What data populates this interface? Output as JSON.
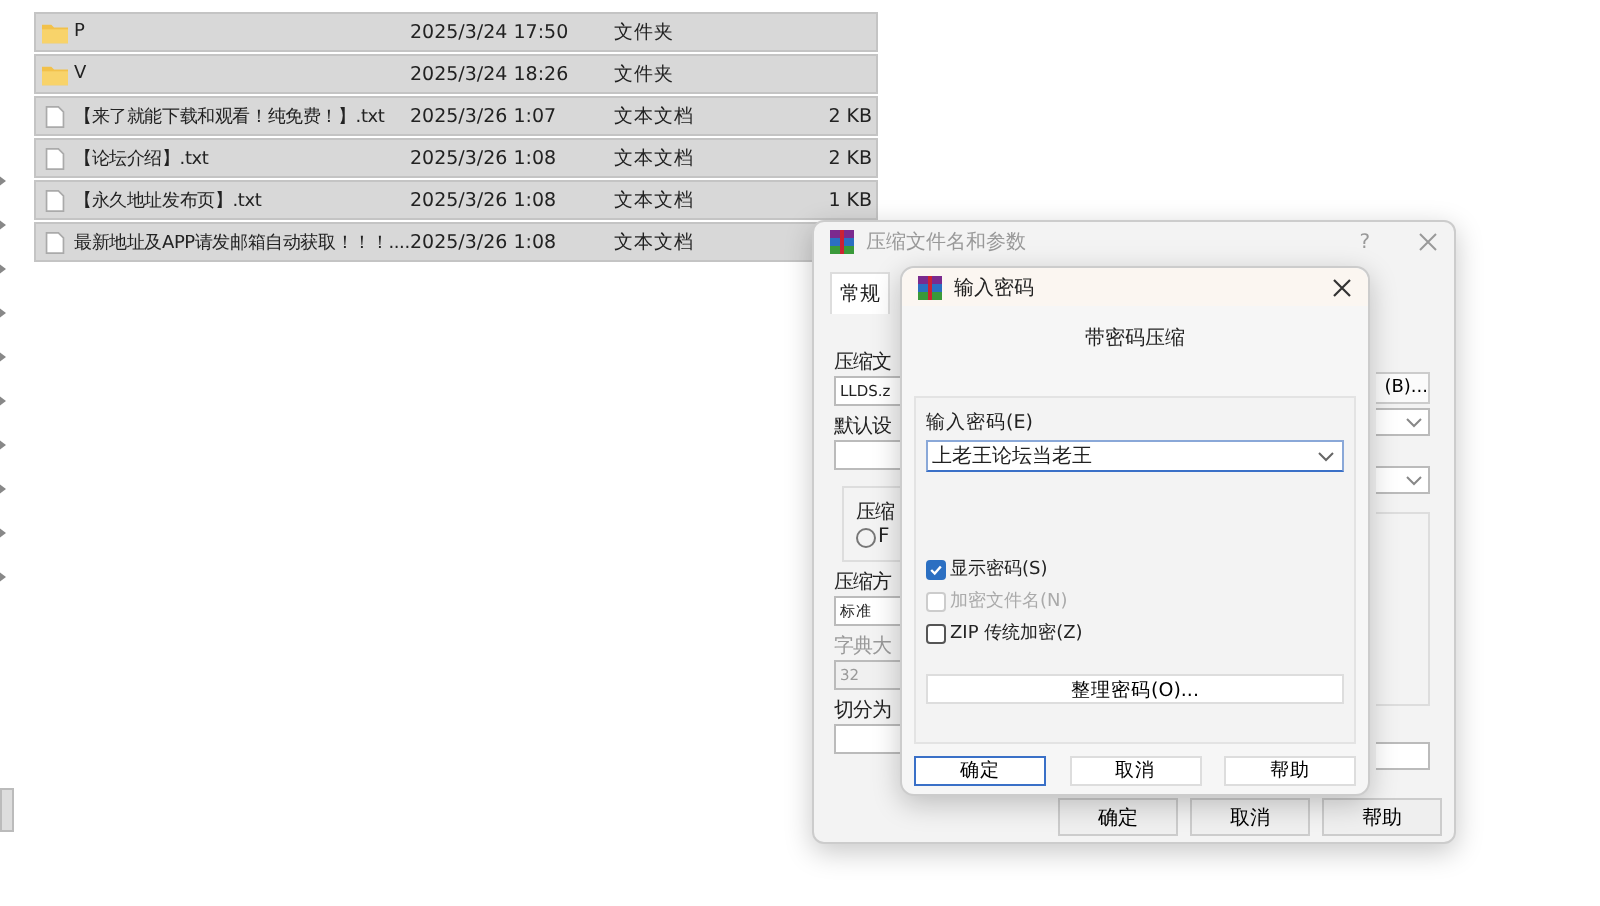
{
  "file_list": {
    "rows": [
      {
        "kind": "folder",
        "name": "P",
        "date": "2025/3/24 17:50",
        "type": "文件夹"
      },
      {
        "kind": "folder",
        "name": "V",
        "date": "2025/3/24 18:26",
        "type": "文件夹"
      },
      {
        "kind": "file",
        "name": "【来了就能下载和观看！纯免费！】.txt",
        "date": "2025/3/26 1:07",
        "type": "文本文档",
        "size": "2 KB"
      },
      {
        "kind": "file",
        "name": "【论坛介绍】.txt",
        "date": "2025/3/26 1:08",
        "type": "文本文档",
        "size": "2 KB"
      },
      {
        "kind": "file",
        "name": "【永久地址发布页】.txt",
        "date": "2025/3/26 1:08",
        "type": "文本文档",
        "size": "1 KB"
      },
      {
        "kind": "file",
        "name": "最新地址及APP请发邮箱自动获取！！！....",
        "date": "2025/3/26 1:08",
        "type": "文本文档"
      }
    ]
  },
  "archive_dialog": {
    "title": "压缩文件名和参数",
    "help_mark": "?",
    "tabs": [
      {
        "label": "常规",
        "selected": true
      }
    ],
    "archive_name_label": "压缩文",
    "archive_name_value": "LLDS.z",
    "browse_button": "(B)...",
    "profile_label": "默认设",
    "format_label": "压缩",
    "format_option": {
      "label": "F",
      "checked": false
    },
    "method_label": "压缩方",
    "method_value": "标准",
    "dictionary_label": "字典大",
    "dictionary_value": "32",
    "split_label": "切分为",
    "buttons": [
      "确定",
      "取消",
      "帮助"
    ]
  },
  "password_dialog": {
    "title": "输入密码",
    "heading": "带密码压缩",
    "password_label": "输入密码(E)",
    "password_value": "上老王论坛当老王",
    "options": [
      {
        "label": "显示密码(S)",
        "checked": true,
        "disabled": false
      },
      {
        "label": "加密文件名(N)",
        "checked": false,
        "disabled": true
      },
      {
        "label": "ZIP 传统加密(Z)",
        "checked": false,
        "disabled": false
      }
    ],
    "organize_button": "整理密码(O)...",
    "buttons": [
      {
        "label": "确定",
        "selected": true
      },
      {
        "label": "取消",
        "selected": false
      },
      {
        "label": "帮助",
        "selected": false
      }
    ]
  }
}
